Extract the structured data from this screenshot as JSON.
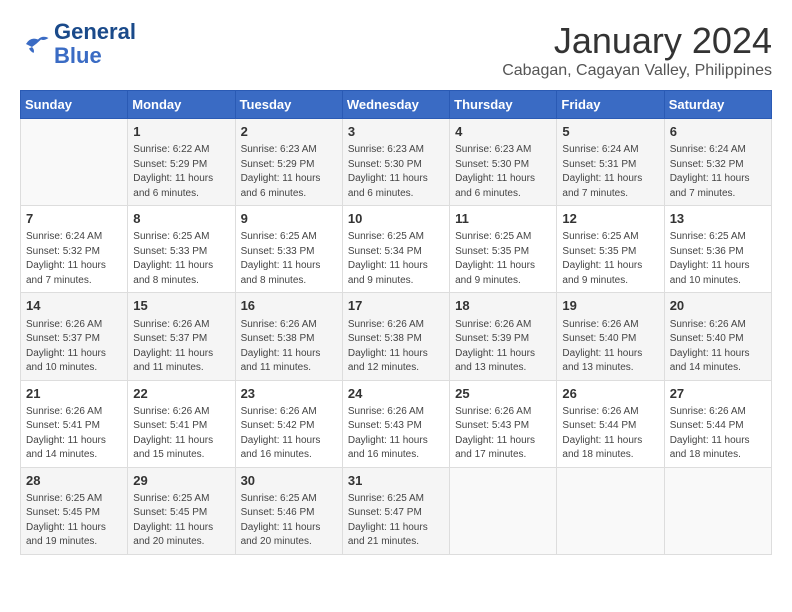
{
  "logo": {
    "line1": "General",
    "line2": "Blue"
  },
  "title": "January 2024",
  "subtitle": "Cabagan, Cagayan Valley, Philippines",
  "headers": [
    "Sunday",
    "Monday",
    "Tuesday",
    "Wednesday",
    "Thursday",
    "Friday",
    "Saturday"
  ],
  "weeks": [
    [
      {
        "day": "",
        "sunrise": "",
        "sunset": "",
        "daylight": ""
      },
      {
        "day": "1",
        "sunrise": "Sunrise: 6:22 AM",
        "sunset": "Sunset: 5:29 PM",
        "daylight": "Daylight: 11 hours and 6 minutes."
      },
      {
        "day": "2",
        "sunrise": "Sunrise: 6:23 AM",
        "sunset": "Sunset: 5:29 PM",
        "daylight": "Daylight: 11 hours and 6 minutes."
      },
      {
        "day": "3",
        "sunrise": "Sunrise: 6:23 AM",
        "sunset": "Sunset: 5:30 PM",
        "daylight": "Daylight: 11 hours and 6 minutes."
      },
      {
        "day": "4",
        "sunrise": "Sunrise: 6:23 AM",
        "sunset": "Sunset: 5:30 PM",
        "daylight": "Daylight: 11 hours and 6 minutes."
      },
      {
        "day": "5",
        "sunrise": "Sunrise: 6:24 AM",
        "sunset": "Sunset: 5:31 PM",
        "daylight": "Daylight: 11 hours and 7 minutes."
      },
      {
        "day": "6",
        "sunrise": "Sunrise: 6:24 AM",
        "sunset": "Sunset: 5:32 PM",
        "daylight": "Daylight: 11 hours and 7 minutes."
      }
    ],
    [
      {
        "day": "7",
        "sunrise": "Sunrise: 6:24 AM",
        "sunset": "Sunset: 5:32 PM",
        "daylight": "Daylight: 11 hours and 7 minutes."
      },
      {
        "day": "8",
        "sunrise": "Sunrise: 6:25 AM",
        "sunset": "Sunset: 5:33 PM",
        "daylight": "Daylight: 11 hours and 8 minutes."
      },
      {
        "day": "9",
        "sunrise": "Sunrise: 6:25 AM",
        "sunset": "Sunset: 5:33 PM",
        "daylight": "Daylight: 11 hours and 8 minutes."
      },
      {
        "day": "10",
        "sunrise": "Sunrise: 6:25 AM",
        "sunset": "Sunset: 5:34 PM",
        "daylight": "Daylight: 11 hours and 9 minutes."
      },
      {
        "day": "11",
        "sunrise": "Sunrise: 6:25 AM",
        "sunset": "Sunset: 5:35 PM",
        "daylight": "Daylight: 11 hours and 9 minutes."
      },
      {
        "day": "12",
        "sunrise": "Sunrise: 6:25 AM",
        "sunset": "Sunset: 5:35 PM",
        "daylight": "Daylight: 11 hours and 9 minutes."
      },
      {
        "day": "13",
        "sunrise": "Sunrise: 6:25 AM",
        "sunset": "Sunset: 5:36 PM",
        "daylight": "Daylight: 11 hours and 10 minutes."
      }
    ],
    [
      {
        "day": "14",
        "sunrise": "Sunrise: 6:26 AM",
        "sunset": "Sunset: 5:37 PM",
        "daylight": "Daylight: 11 hours and 10 minutes."
      },
      {
        "day": "15",
        "sunrise": "Sunrise: 6:26 AM",
        "sunset": "Sunset: 5:37 PM",
        "daylight": "Daylight: 11 hours and 11 minutes."
      },
      {
        "day": "16",
        "sunrise": "Sunrise: 6:26 AM",
        "sunset": "Sunset: 5:38 PM",
        "daylight": "Daylight: 11 hours and 11 minutes."
      },
      {
        "day": "17",
        "sunrise": "Sunrise: 6:26 AM",
        "sunset": "Sunset: 5:38 PM",
        "daylight": "Daylight: 11 hours and 12 minutes."
      },
      {
        "day": "18",
        "sunrise": "Sunrise: 6:26 AM",
        "sunset": "Sunset: 5:39 PM",
        "daylight": "Daylight: 11 hours and 13 minutes."
      },
      {
        "day": "19",
        "sunrise": "Sunrise: 6:26 AM",
        "sunset": "Sunset: 5:40 PM",
        "daylight": "Daylight: 11 hours and 13 minutes."
      },
      {
        "day": "20",
        "sunrise": "Sunrise: 6:26 AM",
        "sunset": "Sunset: 5:40 PM",
        "daylight": "Daylight: 11 hours and 14 minutes."
      }
    ],
    [
      {
        "day": "21",
        "sunrise": "Sunrise: 6:26 AM",
        "sunset": "Sunset: 5:41 PM",
        "daylight": "Daylight: 11 hours and 14 minutes."
      },
      {
        "day": "22",
        "sunrise": "Sunrise: 6:26 AM",
        "sunset": "Sunset: 5:41 PM",
        "daylight": "Daylight: 11 hours and 15 minutes."
      },
      {
        "day": "23",
        "sunrise": "Sunrise: 6:26 AM",
        "sunset": "Sunset: 5:42 PM",
        "daylight": "Daylight: 11 hours and 16 minutes."
      },
      {
        "day": "24",
        "sunrise": "Sunrise: 6:26 AM",
        "sunset": "Sunset: 5:43 PM",
        "daylight": "Daylight: 11 hours and 16 minutes."
      },
      {
        "day": "25",
        "sunrise": "Sunrise: 6:26 AM",
        "sunset": "Sunset: 5:43 PM",
        "daylight": "Daylight: 11 hours and 17 minutes."
      },
      {
        "day": "26",
        "sunrise": "Sunrise: 6:26 AM",
        "sunset": "Sunset: 5:44 PM",
        "daylight": "Daylight: 11 hours and 18 minutes."
      },
      {
        "day": "27",
        "sunrise": "Sunrise: 6:26 AM",
        "sunset": "Sunset: 5:44 PM",
        "daylight": "Daylight: 11 hours and 18 minutes."
      }
    ],
    [
      {
        "day": "28",
        "sunrise": "Sunrise: 6:25 AM",
        "sunset": "Sunset: 5:45 PM",
        "daylight": "Daylight: 11 hours and 19 minutes."
      },
      {
        "day": "29",
        "sunrise": "Sunrise: 6:25 AM",
        "sunset": "Sunset: 5:45 PM",
        "daylight": "Daylight: 11 hours and 20 minutes."
      },
      {
        "day": "30",
        "sunrise": "Sunrise: 6:25 AM",
        "sunset": "Sunset: 5:46 PM",
        "daylight": "Daylight: 11 hours and 20 minutes."
      },
      {
        "day": "31",
        "sunrise": "Sunrise: 6:25 AM",
        "sunset": "Sunset: 5:47 PM",
        "daylight": "Daylight: 11 hours and 21 minutes."
      },
      {
        "day": "",
        "sunrise": "",
        "sunset": "",
        "daylight": ""
      },
      {
        "day": "",
        "sunrise": "",
        "sunset": "",
        "daylight": ""
      },
      {
        "day": "",
        "sunrise": "",
        "sunset": "",
        "daylight": ""
      }
    ]
  ]
}
